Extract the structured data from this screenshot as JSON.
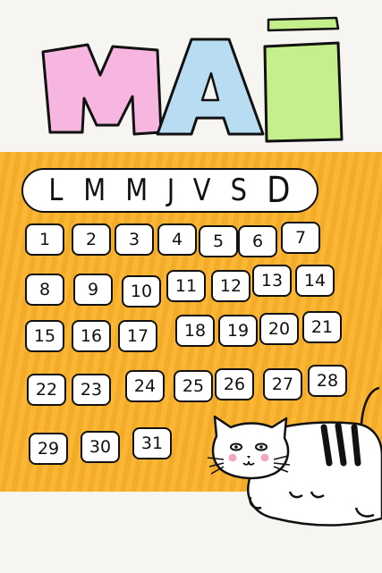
{
  "title": {
    "letters": [
      "M",
      "A",
      "I"
    ],
    "colors": [
      "#f7b6e0",
      "#b8dcf1",
      "#c4ef8a"
    ]
  },
  "weekdays": [
    "L",
    "M",
    "M",
    "J",
    "V",
    "S",
    "D"
  ],
  "days": [
    "1",
    "2",
    "3",
    "4",
    "5",
    "6",
    "7",
    "8",
    "9",
    "10",
    "11",
    "12",
    "13",
    "14",
    "15",
    "16",
    "17",
    "18",
    "19",
    "20",
    "21",
    "22",
    "23",
    "24",
    "25",
    "26",
    "27",
    "28",
    "29",
    "30",
    "31"
  ],
  "colors": {
    "band": "#fbb22a",
    "paper": "#f7f5f2",
    "ink": "#111111",
    "blush": "#f4a6c6"
  }
}
